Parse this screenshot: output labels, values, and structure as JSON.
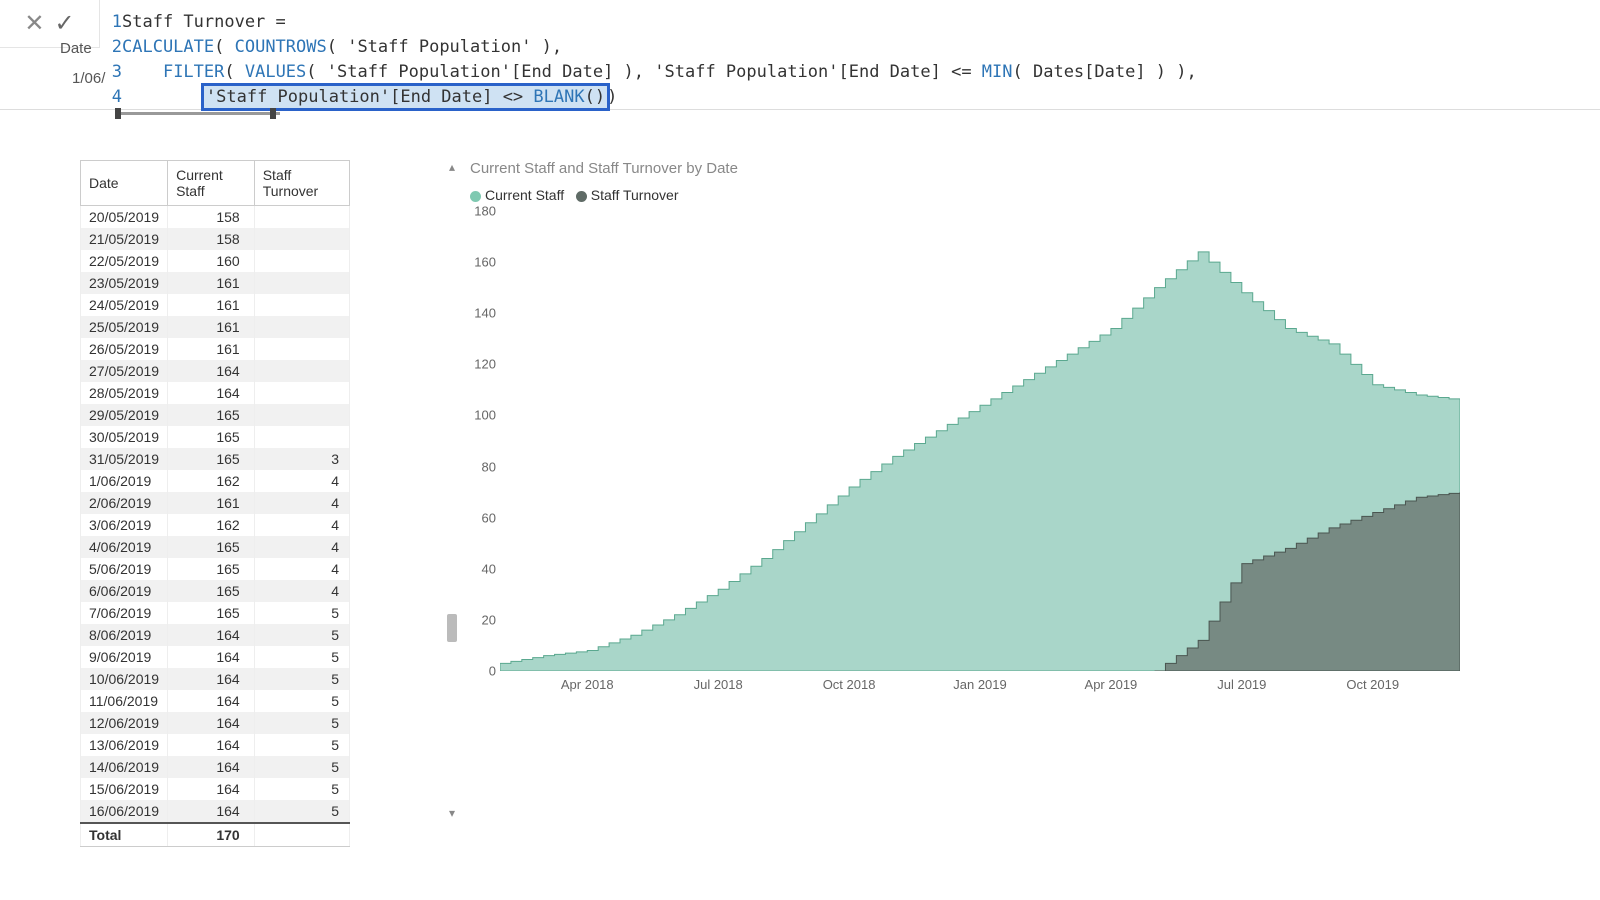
{
  "formula_bar": {
    "close_icon": "✕",
    "commit_icon": "✓",
    "behind_col_label": "Date",
    "behind_date_value": "1/06/",
    "gutter": [
      "1",
      "2",
      "3",
      "4"
    ],
    "line1_a": "Staff Turnover = ",
    "line2_a": "CALCULATE",
    "line2_b": "( ",
    "line2_c": "COUNTROWS",
    "line2_d": "( 'Staff Population' ),",
    "line3_a": "    ",
    "line3_b": "FILTER",
    "line3_c": "( ",
    "line3_d": "VALUES",
    "line3_e": "( 'Staff Population'[End Date] ), 'Staff Population'[End Date] <= ",
    "line3_f": "MIN",
    "line3_g": "( Dates[Date] ) ),",
    "line4_pad": "        ",
    "line4_sel_a": "'Staff Population'[End Date] <> ",
    "line4_sel_b": "BLANK",
    "line4_sel_c": "()",
    "line4_tail": ")"
  },
  "table": {
    "headers": [
      "Date",
      "Current Staff",
      "Staff Turnover"
    ],
    "rows": [
      {
        "d": "20/05/2019",
        "c": "158",
        "t": ""
      },
      {
        "d": "21/05/2019",
        "c": "158",
        "t": ""
      },
      {
        "d": "22/05/2019",
        "c": "160",
        "t": ""
      },
      {
        "d": "23/05/2019",
        "c": "161",
        "t": ""
      },
      {
        "d": "24/05/2019",
        "c": "161",
        "t": ""
      },
      {
        "d": "25/05/2019",
        "c": "161",
        "t": ""
      },
      {
        "d": "26/05/2019",
        "c": "161",
        "t": ""
      },
      {
        "d": "27/05/2019",
        "c": "164",
        "t": ""
      },
      {
        "d": "28/05/2019",
        "c": "164",
        "t": ""
      },
      {
        "d": "29/05/2019",
        "c": "165",
        "t": ""
      },
      {
        "d": "30/05/2019",
        "c": "165",
        "t": ""
      },
      {
        "d": "31/05/2019",
        "c": "165",
        "t": "3"
      },
      {
        "d": "1/06/2019",
        "c": "162",
        "t": "4"
      },
      {
        "d": "2/06/2019",
        "c": "161",
        "t": "4"
      },
      {
        "d": "3/06/2019",
        "c": "162",
        "t": "4"
      },
      {
        "d": "4/06/2019",
        "c": "165",
        "t": "4"
      },
      {
        "d": "5/06/2019",
        "c": "165",
        "t": "4"
      },
      {
        "d": "6/06/2019",
        "c": "165",
        "t": "4"
      },
      {
        "d": "7/06/2019",
        "c": "165",
        "t": "5"
      },
      {
        "d": "8/06/2019",
        "c": "164",
        "t": "5"
      },
      {
        "d": "9/06/2019",
        "c": "164",
        "t": "5"
      },
      {
        "d": "10/06/2019",
        "c": "164",
        "t": "5"
      },
      {
        "d": "11/06/2019",
        "c": "164",
        "t": "5"
      },
      {
        "d": "12/06/2019",
        "c": "164",
        "t": "5"
      },
      {
        "d": "13/06/2019",
        "c": "164",
        "t": "5"
      },
      {
        "d": "14/06/2019",
        "c": "164",
        "t": "5"
      },
      {
        "d": "15/06/2019",
        "c": "164",
        "t": "5"
      },
      {
        "d": "16/06/2019",
        "c": "164",
        "t": "5"
      }
    ],
    "total_label": "Total",
    "total_value": "170"
  },
  "chart": {
    "title": "Current Staff and Staff Turnover by Date",
    "legend_a": "Current Staff",
    "legend_b": "Staff Turnover",
    "colors": {
      "a": "#9acfc0",
      "b": "#6f7d77"
    }
  },
  "chart_data": {
    "type": "area",
    "xlabel": "",
    "ylabel": "",
    "ylim": [
      0,
      180
    ],
    "x_ticks": [
      "Apr 2018",
      "Jul 2018",
      "Oct 2018",
      "Jan 2019",
      "Apr 2019",
      "Jul 2019",
      "Oct 2019"
    ],
    "y_ticks": [
      0,
      20,
      40,
      60,
      80,
      100,
      120,
      140,
      160,
      180
    ],
    "x_domain_months": [
      "Feb 2018",
      "Dec 2019"
    ],
    "series": [
      {
        "name": "Current Staff",
        "color": "#9acfc0",
        "points": [
          {
            "x": "Feb 2018",
            "y": 3
          },
          {
            "x": "Mar 2018",
            "y": 6
          },
          {
            "x": "Apr 2018",
            "y": 8
          },
          {
            "x": "May 2018",
            "y": 14
          },
          {
            "x": "Jun 2018",
            "y": 22
          },
          {
            "x": "Jul 2018",
            "y": 32
          },
          {
            "x": "Aug 2018",
            "y": 44
          },
          {
            "x": "Sep 2018",
            "y": 58
          },
          {
            "x": "Oct 2018",
            "y": 72
          },
          {
            "x": "Nov 2018",
            "y": 84
          },
          {
            "x": "Dec 2018",
            "y": 94
          },
          {
            "x": "Jan 2019",
            "y": 104
          },
          {
            "x": "Feb 2019",
            "y": 114
          },
          {
            "x": "Mar 2019",
            "y": 124
          },
          {
            "x": "Apr 2019",
            "y": 134
          },
          {
            "x": "May 2019",
            "y": 150
          },
          {
            "x": "Jun 2019",
            "y": 164
          },
          {
            "x": "Jul 2019",
            "y": 148
          },
          {
            "x": "Aug 2019",
            "y": 134
          },
          {
            "x": "Sep 2019",
            "y": 128
          },
          {
            "x": "Oct 2019",
            "y": 112
          },
          {
            "x": "Nov 2019",
            "y": 108
          },
          {
            "x": "Dec 2019",
            "y": 106
          }
        ]
      },
      {
        "name": "Staff Turnover",
        "color": "#6f7d77",
        "points": [
          {
            "x": "May 2019",
            "y": 0
          },
          {
            "x": "Jun 2019",
            "y": 12
          },
          {
            "x": "Jul 2019",
            "y": 42
          },
          {
            "x": "Aug 2019",
            "y": 48
          },
          {
            "x": "Sep 2019",
            "y": 56
          },
          {
            "x": "Oct 2019",
            "y": 62
          },
          {
            "x": "Nov 2019",
            "y": 68
          },
          {
            "x": "Dec 2019",
            "y": 70
          }
        ]
      }
    ]
  }
}
